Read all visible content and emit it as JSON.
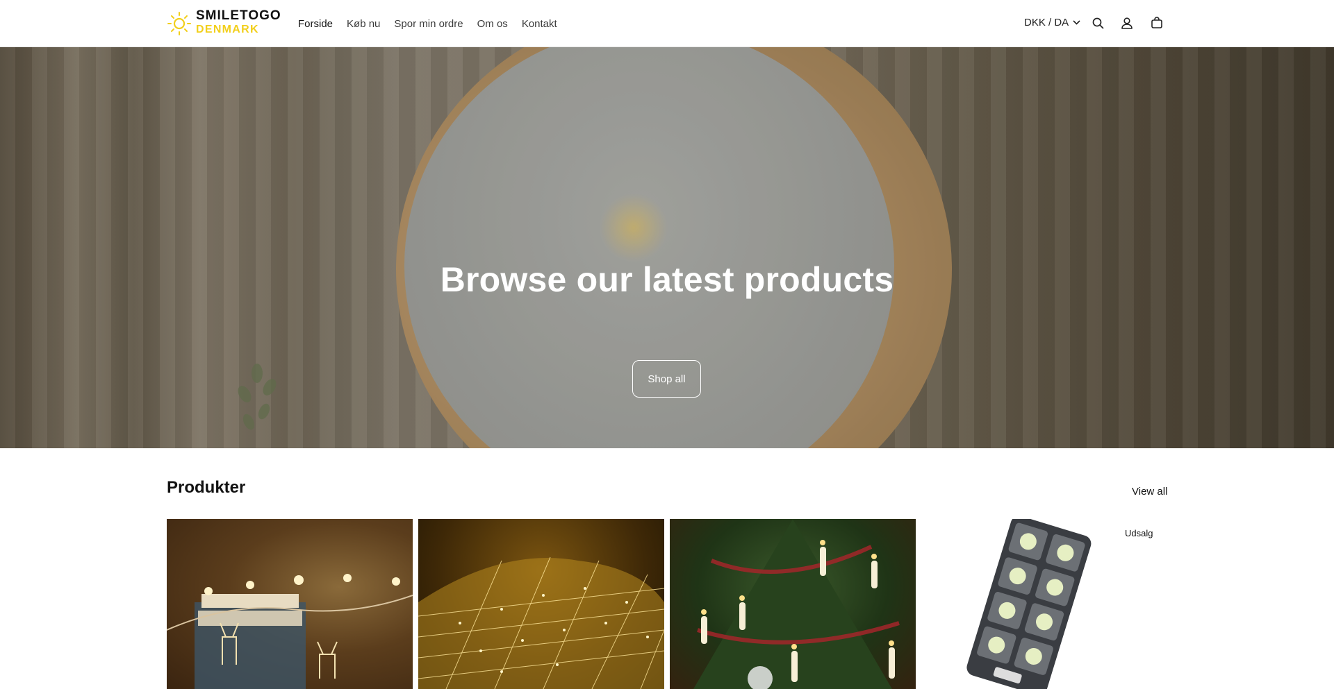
{
  "brand": {
    "name": "SMILETOGO",
    "sub": "DENMARK",
    "accent": "#f2cf1b"
  },
  "nav": [
    {
      "label": "Forside",
      "active": true
    },
    {
      "label": "Køb nu"
    },
    {
      "label": "Spor min ordre"
    },
    {
      "label": "Om os"
    },
    {
      "label": "Kontakt"
    }
  ],
  "header": {
    "locale": "DKK / DA",
    "icons": [
      "search-icon",
      "account-icon",
      "cart-icon"
    ]
  },
  "hero": {
    "title": "Browse our latest products",
    "button_label": "Shop all"
  },
  "products": {
    "title": "Produkter",
    "view_all": "View all",
    "items": [
      {
        "image": "reindeer-string-lights"
      },
      {
        "image": "net-lights"
      },
      {
        "image": "christmas-tree-candle-lights"
      },
      {
        "image": "solar-street-light",
        "badge": "Udsalg"
      }
    ]
  }
}
